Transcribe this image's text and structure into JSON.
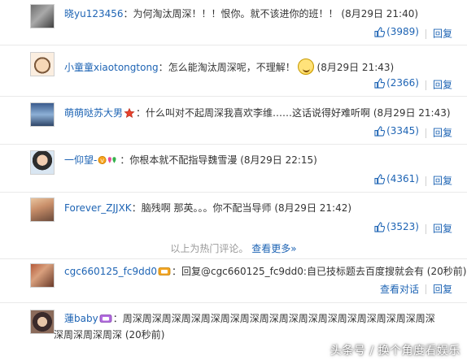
{
  "hot_comments": [
    {
      "user": "晓yu123456",
      "separator": "：",
      "text": "为何淘汰周深！！！恨你。就不该进你的班！！",
      "time": "(8月29日 21:40)",
      "likes": "(3989)",
      "reply": "回复"
    },
    {
      "user": "小童童xiaotongtong",
      "separator": "：",
      "text": "怎么能淘汰周深呢，不理解！",
      "time": "(8月29日 21:43)",
      "likes": "(2366)",
      "reply": "回复"
    },
    {
      "user": "萌萌哒苏大男",
      "separator": "：",
      "text": "什么叫对不起周深我喜欢李维……这话说得好难听啊",
      "time": "(8月29日 21:43)",
      "likes": "(3345)",
      "reply": "回复"
    },
    {
      "user": "一仰望-",
      "separator": "：",
      "text": "你根本就不配指导魏雪漫",
      "time": "(8月29日 22:15)",
      "likes": "(4361)",
      "reply": "回复"
    },
    {
      "user": "Forever_ZJJXK",
      "separator": "：",
      "text": "脑残啊 那英。。。你不配当导师",
      "time": "(8月29日 21:42)",
      "likes": "(3523)",
      "reply": "回复"
    }
  ],
  "hot_tip": {
    "text": "以上为热门评论。",
    "more_link": "查看更多»"
  },
  "recent_comments": [
    {
      "user": "cgc660125_fc9dd0",
      "separator": "：",
      "text": "回复@cgc660125_fc9dd0:自已技标题去百度搜就会有",
      "mention": "@cgc660125_fc9dd0",
      "time": "(20秒前)",
      "view_conversation": "查看对话",
      "reply": "回复"
    },
    {
      "user": "蓮baby",
      "separator": "：",
      "text_line1": "周深周深周深周深周深周深周深周深周深周深周深周深周深周深周深周深",
      "text_line2": "深周深周深周深",
      "time": "(20秒前)"
    }
  ],
  "watermark": "头条号 / 换个角度看娱乐",
  "colors": {
    "link": "#1e64b4",
    "text": "#333333",
    "muted": "#999999",
    "divider": "#e9e9e9"
  },
  "icons": {
    "like": "thumb-up-icon",
    "vip": "vip-badge-icon",
    "star": "star-medal-icon",
    "emoji": "confused-face-emoji-icon"
  }
}
